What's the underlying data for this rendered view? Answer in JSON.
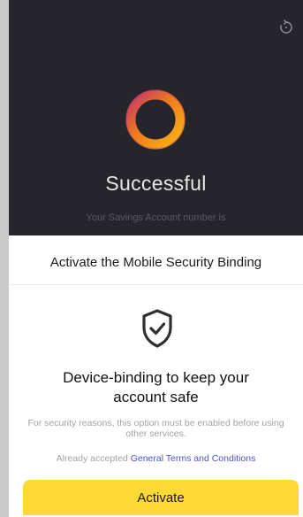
{
  "result": {
    "title": "Successful",
    "account_text": "Your Savings Account number is"
  },
  "binding": {
    "sheet_title": "Activate the Mobile Security Binding",
    "heading": "Device-binding to keep your account safe",
    "description": "For security reasons, this option must be enabled before using other services.",
    "terms_prefix": "Already accepted",
    "terms_link": "General Terms and Conditions",
    "button_label": "Activate"
  },
  "icons": {
    "refresh": "refresh-icon",
    "success": "success-ring-icon",
    "shield": "shield-check-icon"
  },
  "colors": {
    "dark_bg": "#26252b",
    "accent_yellow": "#ffd936",
    "link_blue": "#4a56c7",
    "ring_orange": "#f29b14",
    "ring_magenta": "#c2366b"
  }
}
